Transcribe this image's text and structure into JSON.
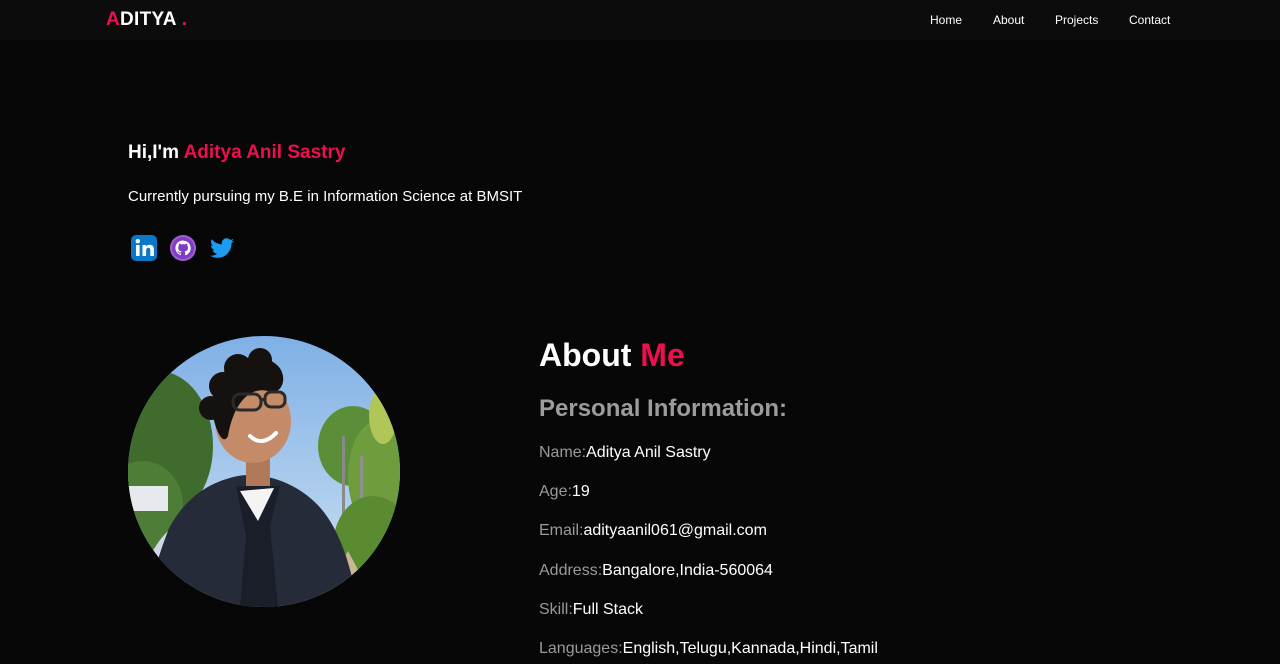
{
  "nav": {
    "logo_first": "A",
    "logo_rest": "DITYA",
    "logo_dot": ".",
    "links": [
      "Home",
      "About",
      "Projects",
      "Contact"
    ]
  },
  "hero": {
    "greeting": "Hi,I'm",
    "name": "Aditya Anil Sastry",
    "subtitle": "Currently pursuing my B.E in Information Science at BMSIT",
    "social_icons": [
      "linkedin-icon",
      "github-icon",
      "twitter-icon"
    ]
  },
  "about": {
    "title_first": "About",
    "title_accent": "Me",
    "info_heading": "Personal Information:",
    "info": [
      {
        "label": "Name:",
        "value": "Aditya Anil Sastry"
      },
      {
        "label": "Age:",
        "value": "19"
      },
      {
        "label": "Email:",
        "value": "adityaanil061@gmail.com"
      },
      {
        "label": "Address:",
        "value": "Bangalore,India-560064"
      },
      {
        "label": "Skill:",
        "value": "Full Stack"
      },
      {
        "label": "Languages:",
        "value": "English,Telugu,Kannada,Hindi,Tamil"
      }
    ]
  },
  "colors": {
    "background": "#070708",
    "navbar": "#0c0c0d",
    "accent": "#ee0f4f",
    "label_gray": "#9a9a9a"
  }
}
